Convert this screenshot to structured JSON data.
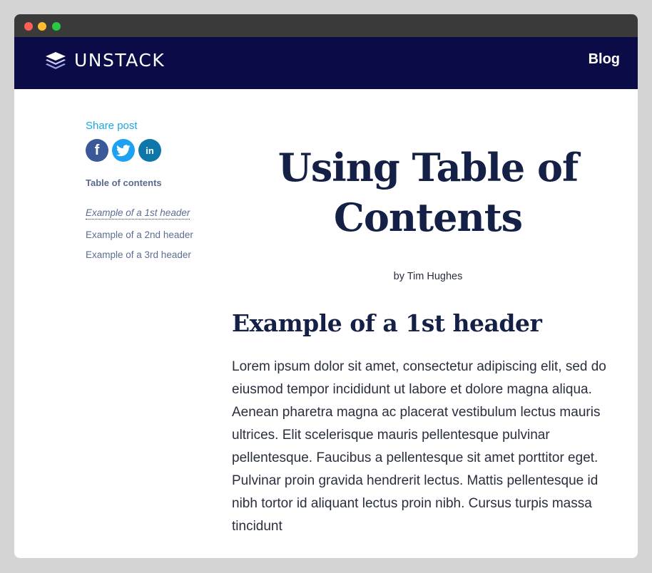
{
  "nav": {
    "brand": "UNSTACK",
    "blog_link": "Blog"
  },
  "sidebar": {
    "share_label": "Share post",
    "share_icons": [
      "facebook-icon",
      "twitter-icon",
      "linkedin-icon"
    ],
    "toc_title": "Table of contents",
    "toc_items": [
      {
        "label": "Example of a 1st header"
      },
      {
        "label": "Example of a 2nd header"
      },
      {
        "label": "Example of a 3rd header"
      }
    ]
  },
  "article": {
    "title": "Using Table of Contents",
    "byline": "by Tim Hughes",
    "section_header": "Example of a 1st header",
    "body": "Lorem ipsum dolor sit amet, consectetur adipiscing elit, sed do eiusmod tempor incididunt ut labore et dolore magna aliqua. Aenean pharetra magna ac placerat vestibulum lectus mauris ultrices. Elit scelerisque mauris pellentesque pulvinar pellentesque. Faucibus a pellentesque sit amet porttitor eget. Pulvinar proin gravida hendrerit lectus. Mattis pellentesque id nibh tortor id aliquant lectus proin nibh. Cursus turpis massa tincidunt"
  },
  "colors": {
    "navbar": "#0b0b48",
    "title": "#152046",
    "share_label": "#1ba6e6",
    "facebook": "#3b5998",
    "twitter": "#1da1f2",
    "linkedin": "#0e76a8"
  }
}
